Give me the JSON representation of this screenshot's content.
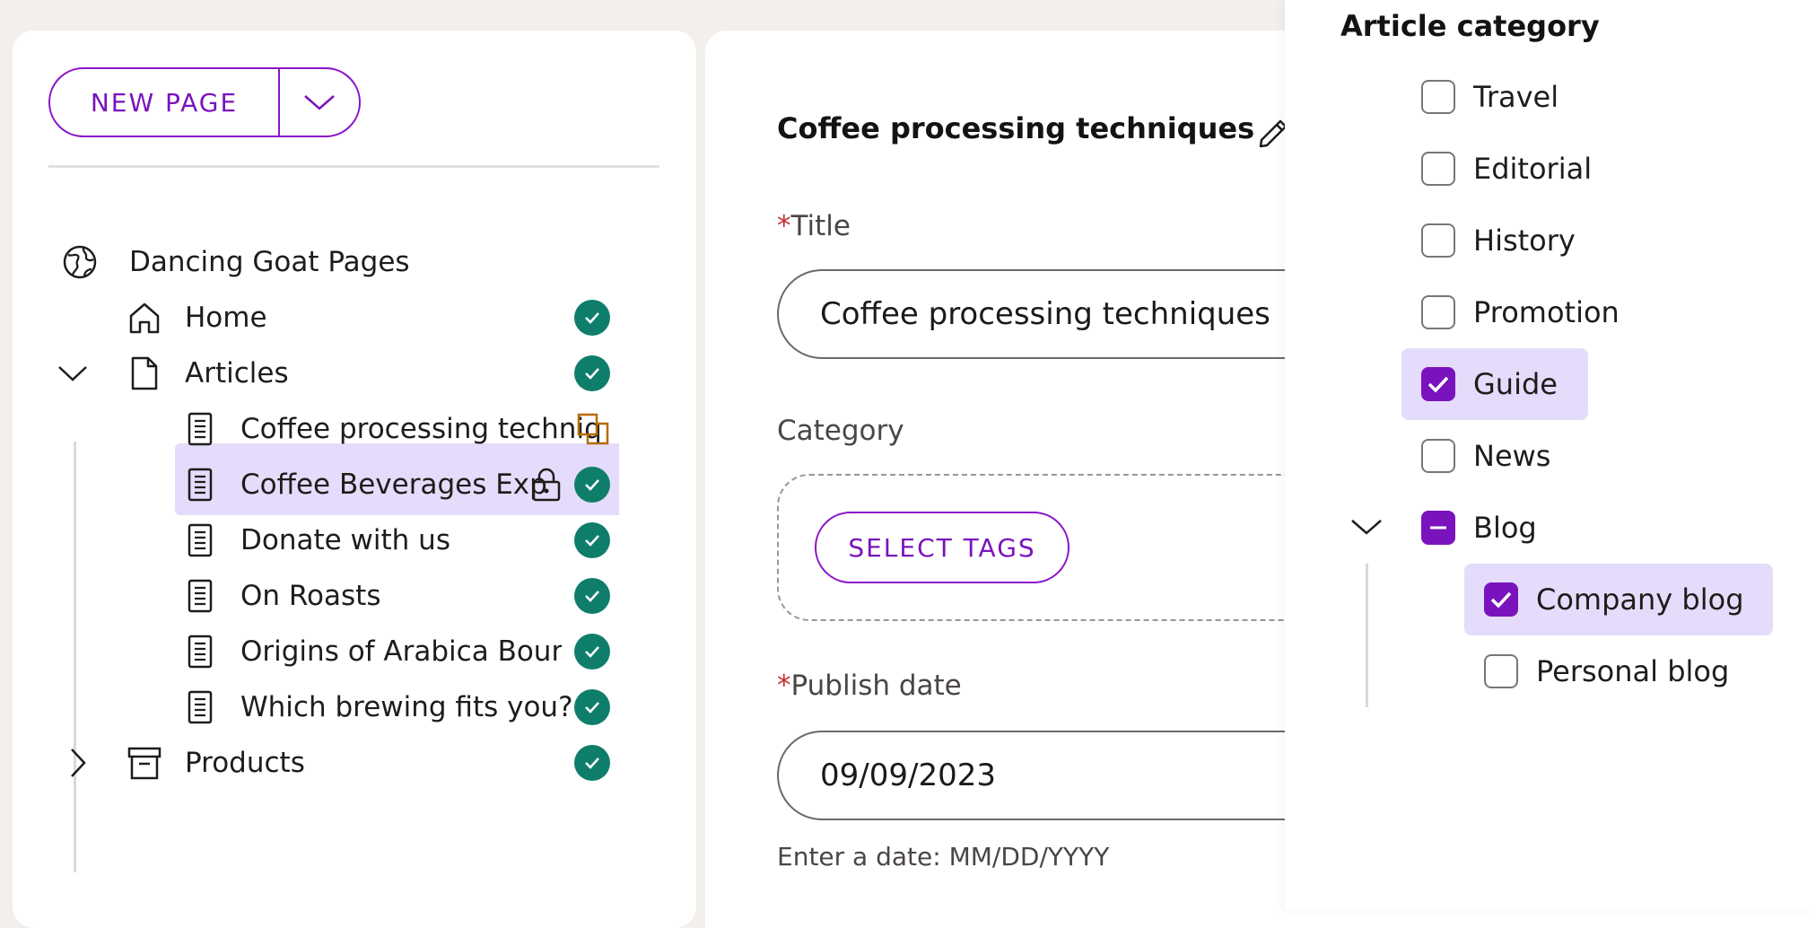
{
  "sidebar": {
    "new_page_label": "NEW PAGE",
    "tree": [
      {
        "label": "Dancing Goat Pages",
        "icon": "globe-icon"
      },
      {
        "label": "Home",
        "icon": "home-icon",
        "status": "published"
      },
      {
        "label": "Articles",
        "icon": "page-icon",
        "status": "published",
        "expanded": true
      },
      {
        "label": "Coffee processing techniq",
        "icon": "article-icon",
        "status": "translation",
        "selected": true
      },
      {
        "label": "Coffee Beverages Exp",
        "icon": "article-icon",
        "status": "published",
        "locked": true
      },
      {
        "label": "Donate with us",
        "icon": "article-icon",
        "status": "published"
      },
      {
        "label": "On Roasts",
        "icon": "article-icon",
        "status": "published"
      },
      {
        "label": "Origins of Arabica Bourbon",
        "icon": "article-icon",
        "status": "published"
      },
      {
        "label": "Which brewing fits you?",
        "icon": "article-icon",
        "status": "published"
      },
      {
        "label": "Products",
        "icon": "archive-icon",
        "status": "published",
        "expanded": false
      }
    ]
  },
  "form": {
    "page_title": "Coffee processing techniques",
    "title_label": "Title",
    "title_value": "Coffee processing techniques",
    "category_label": "Category",
    "select_tags_label": "SELECT TAGS",
    "publish_label": "Publish date",
    "publish_value": "09/09/2023",
    "publish_hint": "Enter a date: MM/DD/YYYY",
    "required_mark": "*"
  },
  "category_dropdown": {
    "title": "Article category",
    "options": [
      {
        "label": "Travel",
        "checked": false
      },
      {
        "label": "Editorial",
        "checked": false
      },
      {
        "label": "History",
        "checked": false
      },
      {
        "label": "Promotion",
        "checked": false
      },
      {
        "label": "Guide",
        "checked": true
      },
      {
        "label": "News",
        "checked": false
      },
      {
        "label": "Blog",
        "checked": "partial",
        "expanded": true
      },
      {
        "label": "Company blog",
        "checked": true
      },
      {
        "label": "Personal blog",
        "checked": false
      }
    ]
  },
  "colors": {
    "accent": "#7a13bd",
    "status_published": "#0e7e6b",
    "status_translation": "#b86a00",
    "selection": "#e4dcfa"
  }
}
